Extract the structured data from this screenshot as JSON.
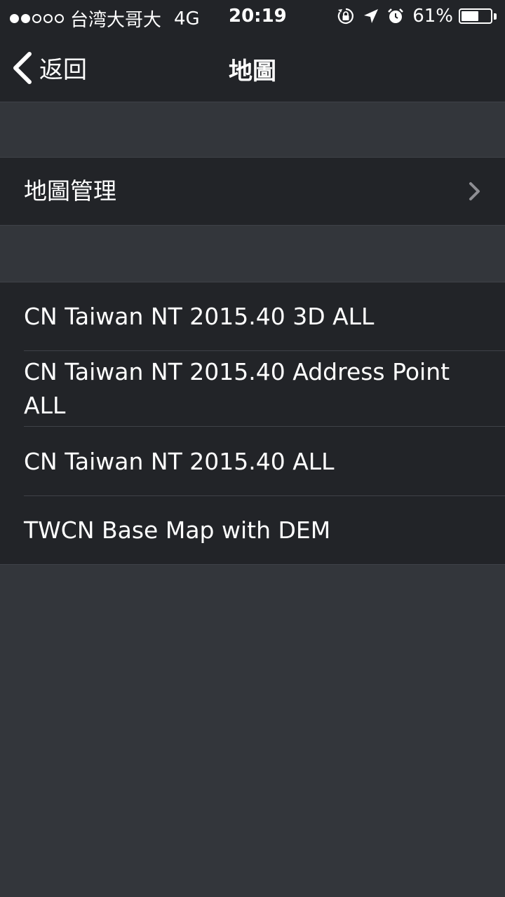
{
  "status_bar": {
    "carrier": "台湾大哥大",
    "network": "4G",
    "time": "20:19",
    "battery_percent": "61%",
    "battery_level": 0.61,
    "signal_bars_filled": 2,
    "signal_bars_total": 5,
    "icons": [
      "rotation-lock-icon",
      "location-arrow-icon",
      "alarm-icon",
      "battery-icon"
    ]
  },
  "nav": {
    "back_label": "返回",
    "title": "地圖"
  },
  "settings": {
    "manage_label": "地圖管理"
  },
  "maps": [
    "CN Taiwan NT 2015.40 3D ALL",
    "CN Taiwan NT 2015.40 Address Point ALL",
    "CN Taiwan NT 2015.40 ALL",
    "TWCN Base Map with DEM"
  ],
  "colors": {
    "bar_background": "#222428",
    "page_background": "#33363b",
    "separator": "#3f4248",
    "text": "#ffffff",
    "chevron": "#8e8e93"
  }
}
